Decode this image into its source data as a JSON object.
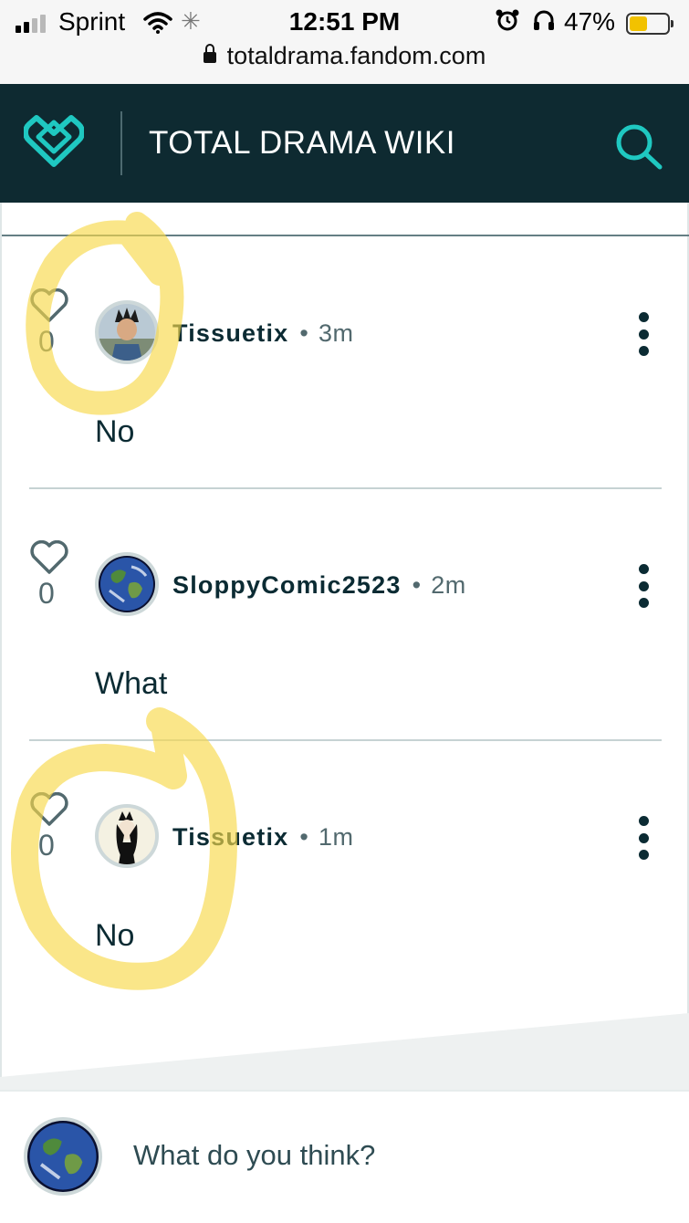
{
  "status_bar": {
    "carrier": "Sprint",
    "time": "12:51 PM",
    "battery_percent": "47%",
    "battery_level": 0.47,
    "signal_bars": 2,
    "icons": [
      "signal-bars-icon",
      "wifi-icon",
      "loading-spinner-icon",
      "alarm-icon",
      "headphones-icon",
      "battery-icon"
    ]
  },
  "browser": {
    "url": "totaldrama.fandom.com",
    "icons": [
      "lock-icon"
    ]
  },
  "header": {
    "wiki_title": "TOTAL DRAMA WIKI",
    "icons": [
      "fandom-heart-logo-icon",
      "search-icon"
    ],
    "colors": {
      "background": "#0e2a31",
      "accent": "#1fc8c1"
    }
  },
  "replies": [
    {
      "username": "Tissuetix",
      "time": "3m",
      "likes": "0",
      "text": "No",
      "avatar": "character-avatar"
    },
    {
      "username": "SloppyComic2523",
      "time": "2m",
      "likes": "0",
      "text": "What",
      "avatar": "earth-avatar"
    },
    {
      "username": "Tissuetix",
      "time": "1m",
      "likes": "0",
      "text": "No",
      "avatar": "character-avatar-2"
    }
  ],
  "reply_icons": [
    "heart-icon",
    "more-options-icon"
  ],
  "composer": {
    "placeholder": "What do you think?",
    "avatar": "earth-avatar"
  },
  "annotations": {
    "highlighter_color": "#f7d84a"
  }
}
